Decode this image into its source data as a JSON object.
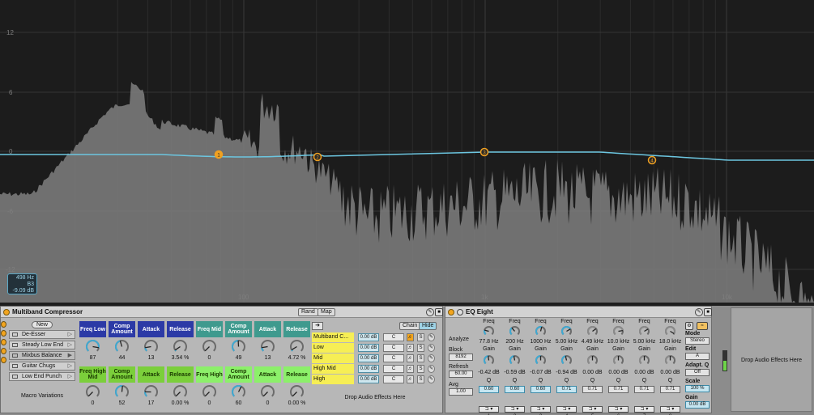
{
  "spectrum": {
    "y_labels": [
      "12",
      "6",
      "0",
      "-6",
      "-12"
    ],
    "x_labels": [
      "100",
      "1k",
      "10k"
    ],
    "readout": [
      "498 Hz",
      "B3",
      "-9.09 dB"
    ],
    "colors": {
      "curve": "#6cc6e0",
      "handle": "#f0a020",
      "fill": "#7a7a7a"
    },
    "handles": [
      "1",
      "2",
      "3",
      "4"
    ]
  },
  "rack": {
    "title": "Multiband Compressor",
    "rand_label": "Rand",
    "map_label": "Map",
    "new_label": "New",
    "variations": [
      "De-Esser",
      "Steady Low End",
      "Mixbus Balance",
      "Guitar Chugs",
      "Low End Punch"
    ],
    "macro_variations_label": "Macro Variations",
    "macros_top": [
      {
        "label": "Freq Low",
        "value": "87",
        "color": "#2c3aa6",
        "text": "#ffffff",
        "level": 0.87
      },
      {
        "label": "Comp Amount",
        "value": "44",
        "color": "#2c3aa6",
        "text": "#ffffff",
        "level": 0.44
      },
      {
        "label": "Attack",
        "value": "13",
        "color": "#2c3aa6",
        "text": "#ffffff",
        "level": 0.13
      },
      {
        "label": "Release",
        "value": "3.54 %",
        "color": "#2c3aa6",
        "text": "#ffffff",
        "level": 0.04
      },
      {
        "label": "Freq Mid",
        "value": "0",
        "color": "#3f9a8e",
        "text": "#ffffff",
        "level": 0
      },
      {
        "label": "Comp Amount",
        "value": "49",
        "color": "#3f9a8e",
        "text": "#ffffff",
        "level": 0.49
      },
      {
        "label": "Attack",
        "value": "13",
        "color": "#3f9a8e",
        "text": "#ffffff",
        "level": 0.13
      },
      {
        "label": "Release",
        "value": "4.72 %",
        "color": "#3f9a8e",
        "text": "#ffffff",
        "level": 0.05
      }
    ],
    "macros_bottom": [
      {
        "label": "Freq High Mid",
        "value": "0",
        "color": "#7bcf3b",
        "text": "#1a3a00",
        "level": 0
      },
      {
        "label": "Comp Amount",
        "value": "52",
        "color": "#7bcf3b",
        "text": "#1a3a00",
        "level": 0.52
      },
      {
        "label": "Attack",
        "value": "17",
        "color": "#7bcf3b",
        "text": "#1a3a00",
        "level": 0.17
      },
      {
        "label": "Release",
        "value": "0.00 %",
        "color": "#7bcf3b",
        "text": "#1a3a00",
        "level": 0
      },
      {
        "label": "Freq High",
        "value": "0",
        "color": "#8cf06a",
        "text": "#1a3a00",
        "level": 0
      },
      {
        "label": "Comp Amount",
        "value": "60",
        "color": "#8cf06a",
        "text": "#1a3a00",
        "level": 0.6
      },
      {
        "label": "Attack",
        "value": "0",
        "color": "#8cf06a",
        "text": "#1a3a00",
        "level": 0
      },
      {
        "label": "Release",
        "value": "0.00 %",
        "color": "#8cf06a",
        "text": "#1a3a00",
        "level": 0
      }
    ],
    "chain_label": "Chain",
    "hide_label": "Hide",
    "chains": [
      {
        "name": "Multiband C...",
        "gain": "0.00 dB",
        "pan": "C"
      },
      {
        "name": "Low",
        "gain": "0.00 dB",
        "pan": "C"
      },
      {
        "name": "Mid",
        "gain": "0.00 dB",
        "pan": "C"
      },
      {
        "name": "High Mid",
        "gain": "0.00 dB",
        "pan": "C"
      },
      {
        "name": "High",
        "gain": "0.00 dB",
        "pan": "C"
      }
    ],
    "solo_label": "S",
    "drop_label": "Drop Audio Effects Here"
  },
  "eq": {
    "title": "EQ Eight",
    "analyze_label": "Analyze",
    "block_label": "Block",
    "block_value": "8192",
    "refresh_label": "Refresh",
    "refresh_value": "60.00",
    "avg_label": "Avg",
    "avg_value": "1.00",
    "freq_label": "Freq",
    "gain_label": "Gain",
    "q_label": "Q",
    "bands": [
      {
        "freq": "77.8 Hz",
        "gain": "-0.42 dB",
        "q": "0.60",
        "num": "1",
        "active": true
      },
      {
        "freq": "200 Hz",
        "gain": "-0.59 dB",
        "q": "0.60",
        "num": "2",
        "active": true
      },
      {
        "freq": "1000 Hz",
        "gain": "-0.07 dB",
        "q": "0.60",
        "num": "3",
        "active": true
      },
      {
        "freq": "5.00 kHz",
        "gain": "-0.94 dB",
        "q": "0.71",
        "num": "4",
        "active": true
      },
      {
        "freq": "4.49 kHz",
        "gain": "0.00 dB",
        "q": "0.71",
        "num": "5",
        "active": false
      },
      {
        "freq": "10.0 kHz",
        "gain": "0.00 dB",
        "q": "0.71",
        "num": "6",
        "active": false
      },
      {
        "freq": "5.00 kHz",
        "gain": "0.00 dB",
        "q": "0.71",
        "num": "7",
        "active": false
      },
      {
        "freq": "18.0 kHz",
        "gain": "0.00 dB",
        "q": "0.71",
        "num": "8",
        "active": false
      }
    ],
    "mode_label": "Mode",
    "mode_value": "Stereo",
    "edit_label": "Edit",
    "adapt_label": "Adapt. Q",
    "adapt_value": "Off",
    "scale_label": "Scale",
    "scale_value": "100 %",
    "gain_out_label": "Gain",
    "gain_out_value": "0.00 dB"
  },
  "drop_right_label": "Drop Audio Effects Here"
}
